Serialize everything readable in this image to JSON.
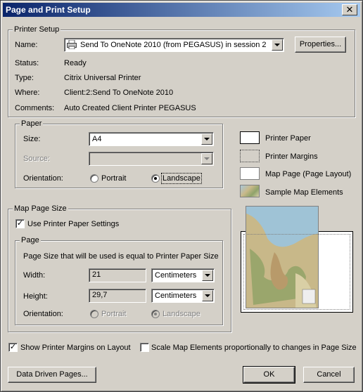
{
  "window": {
    "title": "Page and Print Setup",
    "close_glyph": "✕"
  },
  "printer_setup": {
    "legend": "Printer Setup",
    "name_label": "Name:",
    "name_value": "Send To OneNote 2010 (from PEGASUS) in session 2",
    "properties_button": "Properties...",
    "status_label": "Status:",
    "status_value": "Ready",
    "type_label": "Type:",
    "type_value": "Citrix Universal Printer",
    "where_label": "Where:",
    "where_value": "Client:2:Send To OneNote 2010",
    "comments_label": "Comments:",
    "comments_value": "Auto Created Client Printer PEGASUS"
  },
  "paper": {
    "legend": "Paper",
    "size_label": "Size:",
    "size_value": "A4",
    "source_label": "Source:",
    "source_value": "",
    "orientation_label": "Orientation:",
    "portrait": "Portrait",
    "landscape": "Landscape",
    "selected": "landscape"
  },
  "legend_items": [
    {
      "label": "Printer Paper",
      "icon": "printer-paper-swatch"
    },
    {
      "label": "Printer Margins",
      "icon": "printer-margins-swatch"
    },
    {
      "label": "Map Page (Page Layout)",
      "icon": "map-page-swatch"
    },
    {
      "label": "Sample Map Elements",
      "icon": "sample-map-swatch"
    }
  ],
  "map_page_size": {
    "legend": "Map Page Size",
    "use_printer_paper": "Use Printer Paper Settings",
    "use_printer_paper_checked": true,
    "page": {
      "legend": "Page",
      "info": "Page Size that will be used is equal to Printer Paper Size",
      "width_label": "Width:",
      "width_value": "21",
      "width_unit": "Centimeters",
      "height_label": "Height:",
      "height_value": "29,7",
      "height_unit": "Centimeters",
      "orientation_label": "Orientation:",
      "portrait": "Portrait",
      "landscape": "Landscape",
      "selected": "landscape"
    }
  },
  "options": {
    "show_margins": "Show Printer Margins on Layout",
    "show_margins_checked": true,
    "scale_elements": "Scale Map Elements proportionally to changes in Page Size",
    "scale_elements_checked": false
  },
  "buttons": {
    "data_driven": "Data Driven Pages...",
    "ok": "OK",
    "cancel": "Cancel"
  },
  "colors": {
    "title_start": "#0a246a",
    "title_end": "#a6caf0",
    "face": "#d4d0c8"
  }
}
